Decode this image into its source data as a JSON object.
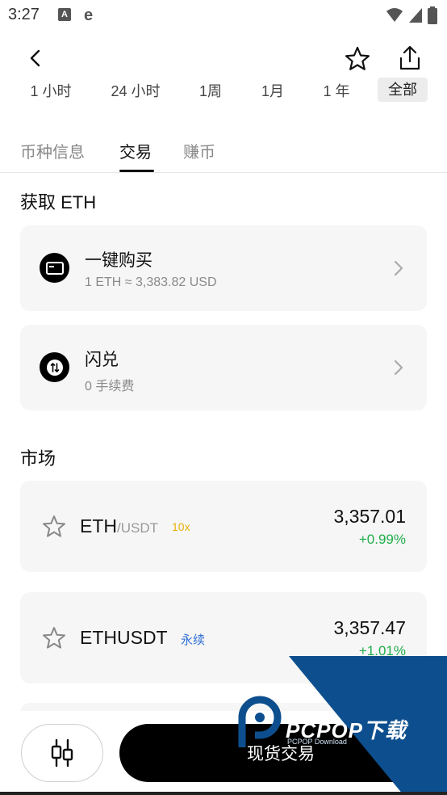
{
  "status": {
    "time": "3:27",
    "a_icon": "A",
    "e_icon": "e"
  },
  "header": {
    "back_icon": "chevron-left-icon",
    "star_icon": "star-outline-icon",
    "share_icon": "share-icon"
  },
  "ranges": [
    "1 小时",
    "24 小时",
    "1周",
    "1月",
    "1 年",
    "全部"
  ],
  "active_range": "全部",
  "tabs": [
    "币种信息",
    "交易",
    "赚币"
  ],
  "active_tab": "交易",
  "acquire": {
    "title": "获取 ETH",
    "actions": [
      {
        "title": "一键购买",
        "subtitle": "1 ETH ≈ 3,383.82 USD",
        "icon": "card-icon"
      },
      {
        "title": "闪兑",
        "subtitle": "0 手续费",
        "icon": "swap-icon"
      }
    ]
  },
  "market": {
    "title": "市场",
    "items": [
      {
        "base": "ETH",
        "quote": "/USDT",
        "badge": "10x",
        "price": "3,357.01",
        "change": "+0.99%"
      },
      {
        "base": "ETHUSDT",
        "quote": "",
        "badge": "永续",
        "price": "3,357.47",
        "change": "+1.01%"
      }
    ]
  },
  "bottom": {
    "chart_icon": "candlestick-icon",
    "trade_label": "现货交易"
  },
  "watermark": {
    "text": "PCPOP下载",
    "sub": "PCPOP Download"
  },
  "colors": {
    "positive": "#1fae4b",
    "leverage": "#e8b10a",
    "perpetual": "#2f6fd6",
    "watermark_blue": "#0d4f8e"
  }
}
